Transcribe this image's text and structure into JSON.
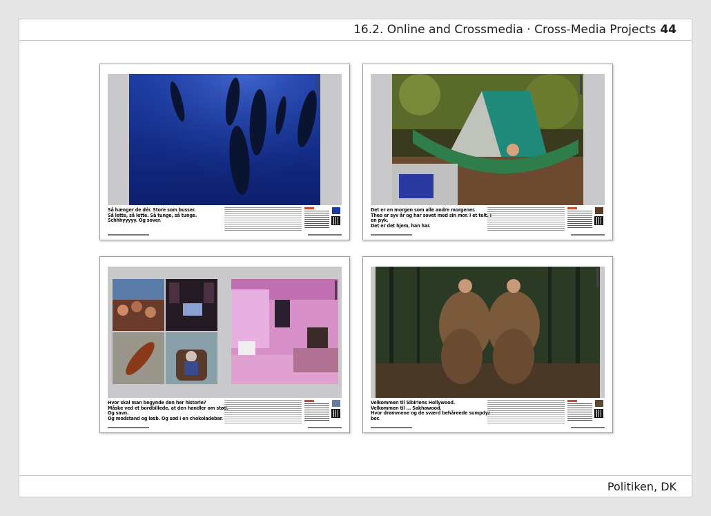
{
  "header": {
    "title": "16.2. Online and Crossmedia · Cross-Media Projects",
    "page_number": "44"
  },
  "footer": {
    "credit": "Politiken, DK"
  },
  "spreads": [
    {
      "caption_lines": [
        "Så hænger de dér. Store som busser.",
        "Så lette, så lette. Så tunge, så tunge.",
        "Schhhyyyyy. Og sover."
      ],
      "image": "whales-underwater"
    },
    {
      "caption_lines": [
        "Det er en morgen som alle andre morgener.",
        "Theo er syv år og har sovet med sin mor. I et telt. I en pyk.",
        "Det er det hjem, han har."
      ],
      "image": "boy-in-hammock-tent"
    },
    {
      "caption_lines": [
        "Hvor skal man begynde den her historie?",
        "Måske ved et bordbillede, at den handler om stød. Og savn.",
        "Og modstand og løsb. Og sød i en chokoladebar."
      ],
      "image": "photo-collage-pink-room"
    },
    {
      "caption_lines": [
        "Velkommen til Sibiriens Hollywood.",
        "Velkommen til ... Sakhawood.",
        "Hvor drømmene og de sværd behåreede sumpdyr bor."
      ],
      "image": "boys-in-fur-costumes-forest"
    }
  ],
  "colors": {
    "accent": "#d04a2a",
    "band": "#c9c9cc"
  }
}
